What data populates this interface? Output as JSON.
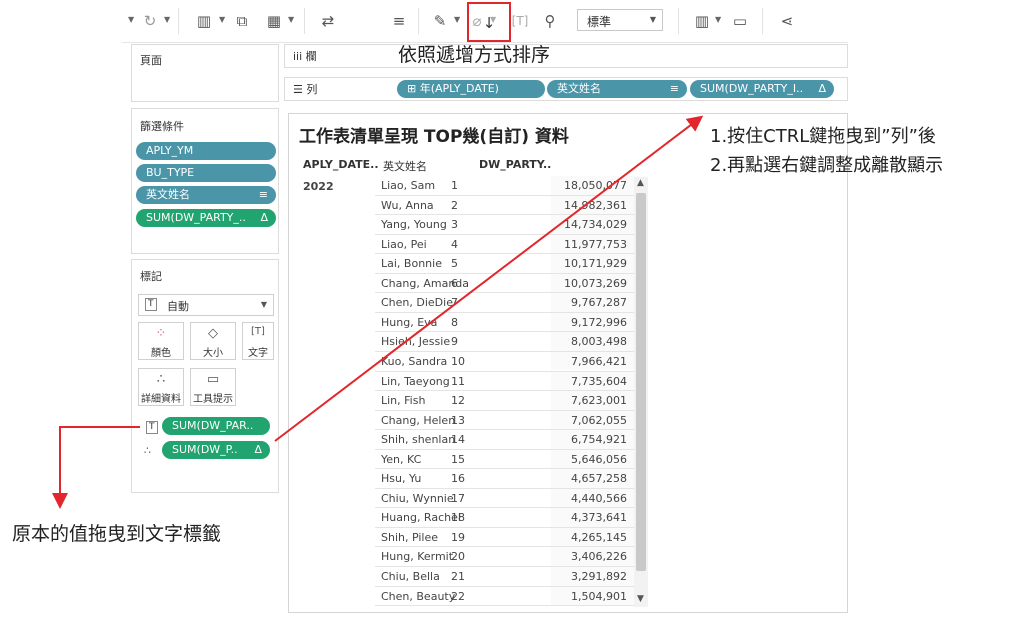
{
  "toolbar": {
    "icons": [
      "refresh-icon",
      "new-worksheet-icon",
      "duplicate-icon",
      "clear-sheet-icon",
      "swap-icon",
      "sort-ascending-icon",
      "sort-descending-icon",
      "highlight-icon",
      "attach-icon",
      "text-label-icon",
      "pin-icon",
      "show-me-icon",
      "presentation-icon",
      "share-icon"
    ],
    "fit_option": "標準"
  },
  "pages_panel": {
    "title": "頁面"
  },
  "filters_panel": {
    "title": "篩選條件",
    "items": [
      {
        "label": "APLY_YM",
        "color": "#4a95a8"
      },
      {
        "label": "BU_TYPE",
        "color": "#4a95a8"
      },
      {
        "label": "英文姓名",
        "suffix": "≡",
        "color": "#4a95a8"
      },
      {
        "label": "SUM(DW_PARTY_..",
        "suffix": "Δ",
        "color": "#21a46f"
      }
    ]
  },
  "marks_panel": {
    "title": "標記",
    "mark_type": "自動",
    "buttons": [
      {
        "label": "顏色",
        "icon": "color-icon"
      },
      {
        "label": "大小",
        "icon": "size-icon"
      },
      {
        "label": "文字",
        "icon": "text-icon"
      },
      {
        "label": "詳細資料",
        "icon": "detail-icon"
      },
      {
        "label": "工具提示",
        "icon": "tooltip-icon"
      }
    ],
    "fields": [
      {
        "label": "SUM(DW_PAR..",
        "icon": "text-icon"
      },
      {
        "label": "SUM(DW_P..",
        "suffix": "Δ",
        "icon": "detail-icon"
      }
    ]
  },
  "columns_shelf": {
    "label": "欄"
  },
  "rows_shelf": {
    "label": "列",
    "pills": [
      {
        "label": "⊞ 年(APLY_DATE)"
      },
      {
        "label": "英文姓名",
        "suffix": "≡"
      },
      {
        "label": "SUM(DW_PARTY_I..",
        "suffix": "Δ"
      }
    ]
  },
  "view": {
    "title": "工作表清單呈現 TOP幾(自訂) 資料",
    "headers": [
      "APLY_DATE..",
      "英文姓名",
      "DW_PARTY.."
    ],
    "year": "2022",
    "rows": [
      {
        "name": "Liao, Sam",
        "rank": "1",
        "value": "18,050,077"
      },
      {
        "name": "Wu, Anna",
        "rank": "2",
        "value": "14,982,361"
      },
      {
        "name": "Yang, Young",
        "rank": "3",
        "value": "14,734,029"
      },
      {
        "name": "Liao, Pei",
        "rank": "4",
        "value": "11,977,753"
      },
      {
        "name": "Lai, Bonnie",
        "rank": "5",
        "value": "10,171,929"
      },
      {
        "name": "Chang, Amanda",
        "rank": "6",
        "value": "10,073,269"
      },
      {
        "name": "Chen, DieDie",
        "rank": "7",
        "value": "9,767,287"
      },
      {
        "name": "Hung, Eva",
        "rank": "8",
        "value": "9,172,996"
      },
      {
        "name": "Hsieh, Jessie",
        "rank": "9",
        "value": "8,003,498"
      },
      {
        "name": "Kuo, Sandra",
        "rank": "10",
        "value": "7,966,421"
      },
      {
        "name": "Lin, Taeyong",
        "rank": "11",
        "value": "7,735,604"
      },
      {
        "name": "Lin, Fish",
        "rank": "12",
        "value": "7,623,001"
      },
      {
        "name": "Chang, Helen",
        "rank": "13",
        "value": "7,062,055"
      },
      {
        "name": "Shih, shenlan",
        "rank": "14",
        "value": "6,754,921"
      },
      {
        "name": "Yen, KC",
        "rank": "15",
        "value": "5,646,056"
      },
      {
        "name": "Hsu, Yu",
        "rank": "16",
        "value": "4,657,258"
      },
      {
        "name": "Chiu, Wynnie",
        "rank": "17",
        "value": "4,440,566"
      },
      {
        "name": "Huang, Rachel",
        "rank": "18",
        "value": "4,373,641"
      },
      {
        "name": "Shih, Pilee",
        "rank": "19",
        "value": "4,265,145"
      },
      {
        "name": "Hung, Kermit",
        "rank": "20",
        "value": "3,406,226"
      },
      {
        "name": "Chiu, Bella",
        "rank": "21",
        "value": "3,291,892"
      },
      {
        "name": "Chen, Beauty",
        "rank": "22",
        "value": "1,504,901"
      }
    ]
  },
  "annotations": {
    "sort_note": "依照遞增方式排序",
    "step1": "1.按住CTRL鍵拖曳到”列”後",
    "step2": "2.再點選右鍵調整成離散顯示",
    "bottom_note": "原本的值拖曳到文字標籤",
    "arrow_color": "#e3262b"
  }
}
